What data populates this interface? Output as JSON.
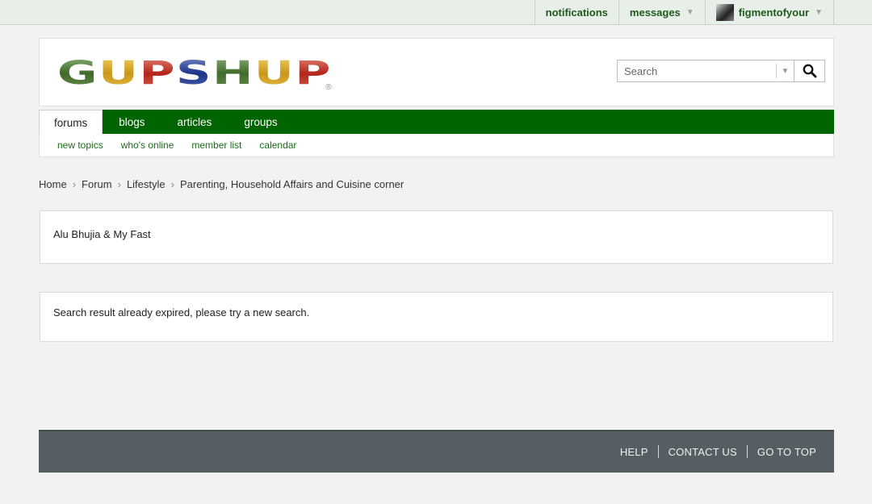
{
  "topbar": {
    "notifications": "notifications",
    "messages": "messages",
    "username": "figmentofyour"
  },
  "brand": {
    "logo_text": "GUPSHUP",
    "registered_mark": "®"
  },
  "search": {
    "placeholder": "Search"
  },
  "nav": {
    "tabs": [
      {
        "label": "forums",
        "active": true
      },
      {
        "label": "blogs",
        "active": false
      },
      {
        "label": "articles",
        "active": false
      },
      {
        "label": "groups",
        "active": false
      }
    ]
  },
  "subnav": {
    "links": [
      "new topics",
      "who's online",
      "member list",
      "calendar"
    ]
  },
  "breadcrumb": [
    "Home",
    "Forum",
    "Lifestyle",
    "Parenting, Household Affairs and Cuisine corner"
  ],
  "thread": {
    "title": "Alu Bhujia & My Fast"
  },
  "message": {
    "text": "Search result already expired, please try a new search."
  },
  "footer": {
    "links": [
      "HELP",
      "CONTACT US",
      "GO TO TOP"
    ]
  },
  "colors": {
    "nav_bg": "#006400",
    "topbar_bg": "#e8efe8",
    "footer_bg": "#555e63",
    "link_green": "#1e6a1e"
  }
}
